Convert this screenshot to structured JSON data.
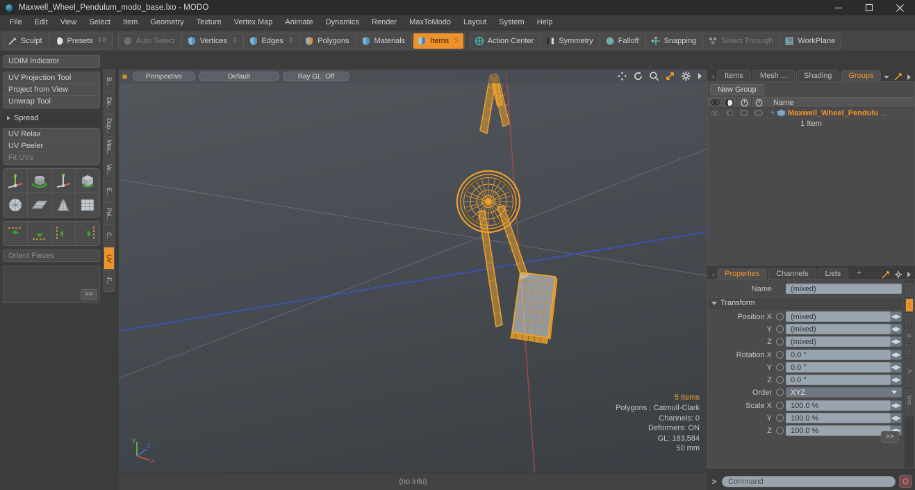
{
  "window": {
    "title": "Maxwell_Wheel_Pendulum_modo_base.lxo - MODO",
    "app_icon": "modo-sphere-icon",
    "minimize": "minimize-icon",
    "maximize": "maximize-icon",
    "close": "close-icon"
  },
  "menubar": {
    "items": [
      {
        "label": "File"
      },
      {
        "label": "Edit"
      },
      {
        "label": "View"
      },
      {
        "label": "Select"
      },
      {
        "label": "Item"
      },
      {
        "label": "Geometry"
      },
      {
        "label": "Texture"
      },
      {
        "label": "Vertex Map"
      },
      {
        "label": "Animate"
      },
      {
        "label": "Dynamics"
      },
      {
        "label": "Render"
      },
      {
        "label": "MaxToModo"
      },
      {
        "label": "Layout"
      },
      {
        "label": "System"
      },
      {
        "label": "Help"
      }
    ]
  },
  "toolbar": {
    "group1": [
      {
        "label": "Sculpt",
        "icon": "brush-icon",
        "state": "normal",
        "num": ""
      },
      {
        "label": "Presets",
        "icon": "sphere-icon",
        "state": "normal",
        "num": "F6"
      }
    ],
    "group2": [
      {
        "label": "Auto Select",
        "icon": "shield-grey-icon",
        "state": "disabled",
        "num": ""
      },
      {
        "label": "Vertices",
        "icon": "shield-blue-icon",
        "state": "normal",
        "num": "1"
      },
      {
        "label": "Edges",
        "icon": "shield-blue-icon",
        "state": "normal",
        "num": "2"
      },
      {
        "label": "Polygons",
        "icon": "shield-blue-icon",
        "state": "normal",
        "num": ""
      },
      {
        "label": "Materials",
        "icon": "shield-blue-icon",
        "state": "normal",
        "num": ""
      },
      {
        "label": "Items",
        "icon": "shield-orange-icon",
        "state": "active",
        "num": "5"
      }
    ],
    "group3": [
      {
        "label": "Action Center",
        "icon": "target-icon",
        "state": "normal",
        "num": ""
      },
      {
        "label": "Symmetry",
        "icon": "mirror-icon",
        "state": "normal",
        "num": ""
      },
      {
        "label": "Falloff",
        "icon": "falloff-icon",
        "state": "normal",
        "num": ""
      },
      {
        "label": "Snapping",
        "icon": "snap-icon",
        "state": "normal",
        "num": ""
      },
      {
        "label": "Select Through",
        "icon": "select-through-icon",
        "state": "disabled",
        "num": ""
      },
      {
        "label": "WorkPlane",
        "icon": "workplane-icon",
        "state": "normal",
        "num": ""
      }
    ]
  },
  "left_panel": {
    "box1": [
      {
        "label": "UDIM Indicator",
        "state": "normal"
      }
    ],
    "box2": [
      {
        "label": "UV Projection Tool",
        "state": "normal"
      },
      {
        "label": "Project from View",
        "state": "normal"
      },
      {
        "label": "Unwrap Tool",
        "state": "normal"
      }
    ],
    "spread_header": "Spread",
    "box3": [
      {
        "label": "UV Relax",
        "state": "normal"
      },
      {
        "label": "UV Peeler",
        "state": "normal"
      },
      {
        "label": "Fit UVs",
        "state": "disabled"
      }
    ],
    "icon_grid_1": [
      "uv-move-axis-icon",
      "uv-rotate-cylinder-icon",
      "uv-scale-axis-icon",
      "uv-flip-box-icon"
    ],
    "icon_grid_2": [
      "uv-sphere-grid-icon",
      "uv-flat-grid-icon",
      "uv-cone-grid-icon",
      "uv-box-grid-icon"
    ],
    "icon_grid_3": [
      "uv-align-up-icon",
      "uv-align-down-icon",
      "uv-align-left-icon",
      "uv-align-right-icon"
    ],
    "orient_field": "Orient Pieces",
    "expand_button": ">>",
    "vertical_tabs": [
      {
        "label": "B...",
        "active": false
      },
      {
        "label": "De...",
        "active": false
      },
      {
        "label": "Dup...",
        "active": false
      },
      {
        "label": "Mes...",
        "active": false
      },
      {
        "label": "Ve...",
        "active": false
      },
      {
        "label": "E...",
        "active": false
      },
      {
        "label": "Pol...",
        "active": false
      },
      {
        "label": "C...",
        "active": false
      },
      {
        "label": "UV",
        "active": true
      },
      {
        "label": "F...",
        "active": false
      }
    ]
  },
  "viewport": {
    "view_mode": "Perspective",
    "shading": "Default",
    "raygl": "Ray GL: Off",
    "icons": [
      "pan-icon",
      "rotate-icon",
      "zoom-icon",
      "fit-icon",
      "gear-icon",
      "play-icon"
    ],
    "stats": {
      "items": "5 Items",
      "polygons": "Polygons : Catmull-Clark",
      "channels": "Channels: 0",
      "deformers": "Deformers: ON",
      "gl": "GL: 183,584",
      "scale": "50 mm"
    },
    "axis_labels": {
      "y": "Y",
      "x": "X",
      "z": "Z"
    },
    "model_name": "maxwell-wheel-pendulum-wireframe"
  },
  "right_panel": {
    "top_tabs": [
      {
        "label": "Items",
        "active": false
      },
      {
        "label": "Mesh ...",
        "active": false
      },
      {
        "label": "Shading",
        "active": false
      },
      {
        "label": "Groups",
        "active": true
      }
    ],
    "top_tab_caret": "chevron-down-icon",
    "expand_icon": "expand-icon",
    "more_icon": "play-icon",
    "new_group_button": "New Group",
    "list_columns": [
      "eye-icon",
      "shading-icon",
      "lock-icon",
      "render-icon"
    ],
    "name_header": "Name",
    "group_item": {
      "name": "Maxwell_Wheel_Pendulu",
      "ellipsis": "...",
      "icon": "mesh-item-icon",
      "child_count": "1 Item"
    },
    "prop_tabs": [
      {
        "label": "Properties",
        "active": true
      },
      {
        "label": "Channels",
        "active": false
      },
      {
        "label": "Lists",
        "active": false
      },
      {
        "label": "+",
        "active": false
      }
    ],
    "name_label": "Name",
    "name_value": "(mixed)",
    "transform_header": "Transform",
    "transform": [
      {
        "label": "Position X",
        "value": "(mixed)"
      },
      {
        "label": "Y",
        "value": "(mixed)"
      },
      {
        "label": "Z",
        "value": "(mixed)"
      },
      {
        "label": "Rotation X",
        "value": "0.0 °"
      },
      {
        "label": "Y",
        "value": "0.0 °"
      },
      {
        "label": "Z",
        "value": "0.0 °"
      }
    ],
    "order_label": "Order",
    "order_value": "XYZ",
    "scale": [
      {
        "label": "Scale X",
        "value": "100.0 %"
      },
      {
        "label": "Y",
        "value": "100.0 %"
      },
      {
        "label": "Z",
        "value": "100.0 %"
      }
    ],
    "expand_button": ">>",
    "side_buttons": [
      "A...",
      "Use..."
    ]
  },
  "statusbar": {
    "text": "(no info)"
  },
  "command_bar": {
    "prompt": ">",
    "placeholder": "Command",
    "record_button": "record-icon"
  },
  "colors": {
    "accent": "#f0922b",
    "wire": "#f0a22a",
    "panel": "#3c3c3c",
    "field": "#9aa4ae"
  }
}
